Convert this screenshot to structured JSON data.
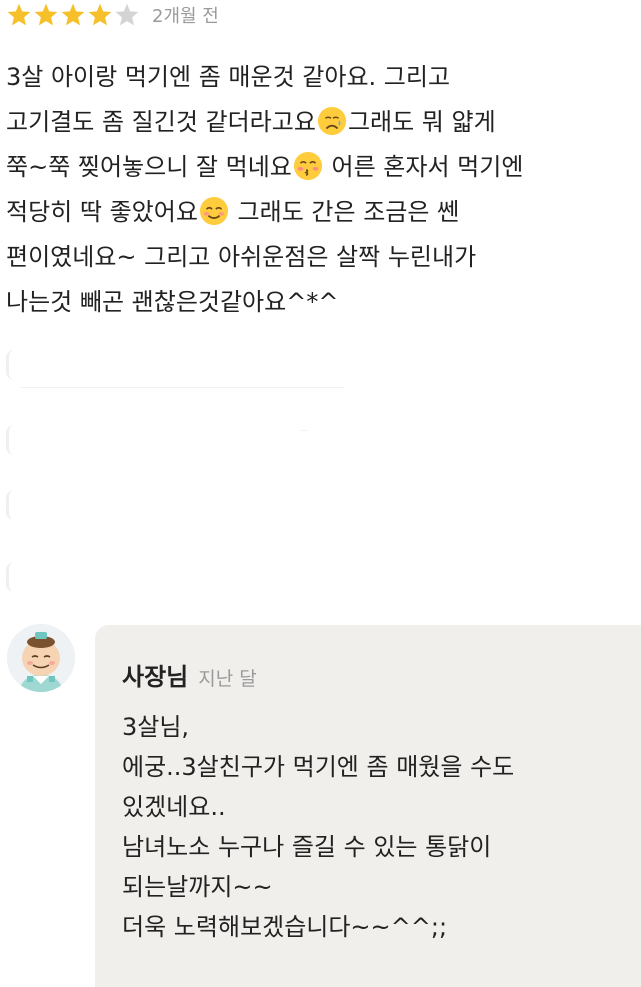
{
  "review": {
    "rating": 4,
    "max_rating": 5,
    "date": "2개월 전",
    "text": {
      "line1": "3살 아이랑 먹기엔 좀 매운것 같아요. 그리고",
      "line2a": "고기결도 좀 질긴것 같더라고요",
      "line2b": "그래도 뭐 얇게",
      "line3a": "쭉~쭉 찢어놓으니 잘 먹네요",
      "line3b": " 어른 혼자서 먹기엔",
      "line4a": "적당히 딱 좋았어요",
      "line4b": " 그래도 간은 조금은 쎈",
      "line5": "편이였네요~ 그리고 아쉬운점은 살짝 누린내가",
      "line6": "나는것 빼곤 괜찮은것같아요^*^"
    },
    "emojis": [
      "sad-tear-face-emoji",
      "kissing-face-emoji",
      "smiling-face-emoji"
    ]
  },
  "reply": {
    "author": "사장님",
    "time": "지난 달",
    "lines": [
      "3살님,",
      "에궁..3살친구가 먹기엔 좀 매웠을 수도",
      "있겠네요..",
      "남녀노소 누구나 즐길 수 있는 통닭이",
      "되는날까지~~",
      "더욱 노력해보겠습니다~~^^;;"
    ]
  },
  "colors": {
    "star_filled": "#f6c02b",
    "star_empty": "#d4d4d4",
    "reply_bg": "#f1efec",
    "muted_text": "#9a9a9a"
  }
}
